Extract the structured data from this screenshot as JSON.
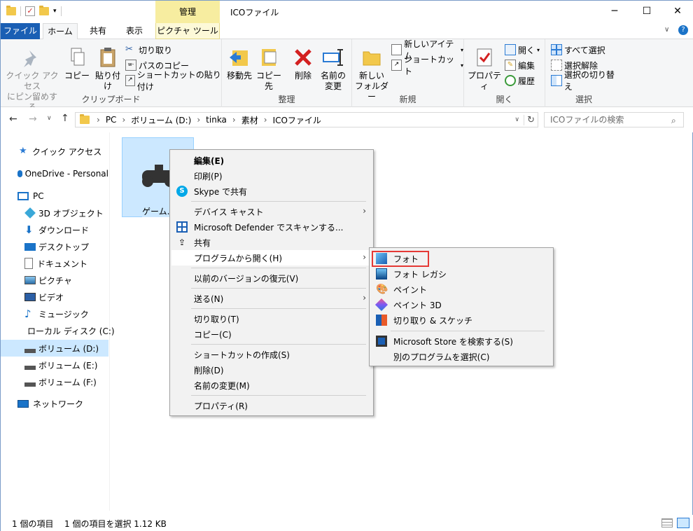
{
  "title_bar": {
    "manage_tab": "管理",
    "window_title": "ICOファイル",
    "minimize": "─",
    "maximize": "☐",
    "close": "✕"
  },
  "ribbon_tabs": [
    "ファイル",
    "ホーム",
    "共有",
    "表示",
    "ピクチャ ツール"
  ],
  "ribbon": {
    "clipboard": {
      "label": "クリップボード",
      "pin_quick_access": [
        "クイック アクセス",
        "にピン留めする"
      ],
      "copy": "コピー",
      "paste": "貼り付け",
      "cut": "切り取り",
      "copy_path": "パスのコピー",
      "paste_shortcut": "ショートカットの貼り付け"
    },
    "organize": {
      "label": "整理",
      "move_to": "移動先",
      "copy_to": "コピー先",
      "delete": "削除",
      "rename": [
        "名前の",
        "変更"
      ]
    },
    "new": {
      "label": "新規",
      "new_folder": [
        "新しい",
        "フォルダー"
      ],
      "new_item": "新しいアイテム",
      "shortcut": "ショートカット"
    },
    "open": {
      "label": "開く",
      "properties": "プロパティ",
      "open": "開く",
      "edit": "編集",
      "history": "履歴"
    },
    "select": {
      "label": "選択",
      "select_all": "すべて選択",
      "select_none": "選択解除",
      "invert": "選択の切り替え"
    }
  },
  "address": {
    "breadcrumb": [
      "PC",
      "ボリューム (D:)",
      "tinka",
      "素材",
      "ICOファイル"
    ],
    "search_placeholder": "ICOファイルの検索"
  },
  "nav_pane": [
    {
      "label": "クイック アクセス",
      "icon": "star-icon"
    },
    {
      "label": "OneDrive - Personal",
      "icon": "cloud-icon"
    },
    {
      "label": "PC",
      "icon": "pc-icon"
    },
    {
      "label": "3D オブジェクト",
      "icon": "cube-icon"
    },
    {
      "label": "ダウンロード",
      "icon": "download-icon"
    },
    {
      "label": "デスクトップ",
      "icon": "desktop-icon"
    },
    {
      "label": "ドキュメント",
      "icon": "document-icon"
    },
    {
      "label": "ピクチャ",
      "icon": "picture-icon"
    },
    {
      "label": "ビデオ",
      "icon": "video-icon"
    },
    {
      "label": "ミュージック",
      "icon": "music-icon"
    },
    {
      "label": "ローカル ディスク (C:)",
      "icon": "disk-icon"
    },
    {
      "label": "ボリューム (D:)",
      "icon": "drive-icon"
    },
    {
      "label": "ボリューム (E:)",
      "icon": "drive-icon"
    },
    {
      "label": "ボリューム (F:)",
      "icon": "drive-icon"
    },
    {
      "label": "ネットワーク",
      "icon": "network-icon"
    }
  ],
  "file": {
    "name": "ゲーム.ic"
  },
  "context_menu": [
    {
      "label": "編集(E)",
      "bold": true
    },
    {
      "label": "印刷(P)"
    },
    {
      "label": "Skype で共有",
      "icon": "skype-icon"
    },
    {
      "label": "デバイス キャスト",
      "submenu": true
    },
    {
      "label": "Microsoft Defender でスキャンする...",
      "icon": "defender-icon"
    },
    {
      "label": "共有",
      "icon": "share-icon"
    },
    {
      "label": "プログラムから開く(H)",
      "submenu": true
    },
    {
      "label": "以前のバージョンの復元(V)"
    },
    {
      "label": "送る(N)",
      "submenu": true
    },
    {
      "label": "切り取り(T)"
    },
    {
      "label": "コピー(C)"
    },
    {
      "label": "ショートカットの作成(S)"
    },
    {
      "label": "削除(D)"
    },
    {
      "label": "名前の変更(M)"
    },
    {
      "label": "プロパティ(R)"
    }
  ],
  "open_with_menu": [
    {
      "label": "フォト",
      "icon": "photos-icon"
    },
    {
      "label": "フォト レガシ",
      "icon": "photos-legacy-icon"
    },
    {
      "label": "ペイント",
      "icon": "paint-icon"
    },
    {
      "label": "ペイント 3D",
      "icon": "paint3d-icon"
    },
    {
      "label": "切り取り & スケッチ",
      "icon": "snip-sketch-icon"
    },
    {
      "label": "Microsoft Store を検索する(S)",
      "icon": "store-icon"
    },
    {
      "label": "別のプログラムを選択(C)"
    }
  ],
  "status": {
    "count": "1 個の項目",
    "selected": "1 個の項目を選択  1.12 KB"
  },
  "colors": {
    "accent": "#1a5fb4",
    "selection": "#cce8ff",
    "highlight_box": "#e53935",
    "manage_tab": "#f7eda0"
  }
}
